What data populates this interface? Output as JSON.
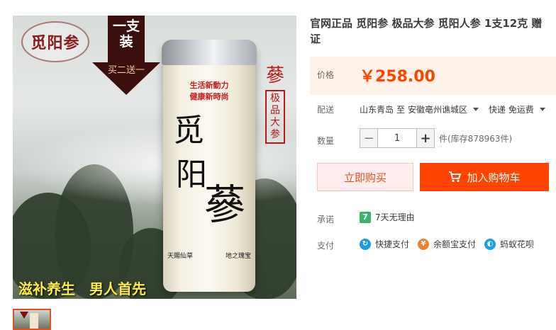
{
  "image": {
    "brand_seal": "觅阳参",
    "promo_line": "一支装",
    "promo_ribbon": "买二送一",
    "can": {
      "slogan_1": "生活新動力",
      "slogan_2": "健康新時尚",
      "calligraphy": [
        "觅",
        "阳",
        "蔘"
      ],
      "bottom_left": "天賜仙草",
      "bottom_right": "地之瑰宝"
    },
    "side_big": "蔘",
    "side_box": "极品大参",
    "bottom_slogan_1": "滋补养生",
    "bottom_slogan_2": "男人首先"
  },
  "title": {
    "line1": "官网正品 觅阳参 极品大参 觅阳人参 1支12克 赠",
    "line2": "证"
  },
  "price": {
    "label": "价格",
    "value": "￥258.00",
    "color": "#ff4400"
  },
  "shipping": {
    "label": "配送",
    "origin": "山东青岛",
    "to": "至",
    "destination": "安徽亳州谯城区",
    "method": "快递 免运费"
  },
  "quantity": {
    "label": "数量",
    "value": "1",
    "minus": "−",
    "plus": "+",
    "stock": "件(库存878963件)"
  },
  "buttons": {
    "buy_now": "立即购买",
    "add_cart": "加入购物车",
    "cart_icon": "cart-icon"
  },
  "promise": {
    "label": "承诺",
    "icon_text": "7",
    "text": "7天无理由"
  },
  "payment": {
    "label": "支付",
    "methods": [
      {
        "icon": "quick-pay-icon",
        "label": "快捷支付",
        "color": "#1d9be0"
      },
      {
        "icon": "yuebao-icon",
        "label": "余额宝支付",
        "color": "#f0812c"
      },
      {
        "icon": "huabei-icon",
        "label": "蚂蚁花呗",
        "color": "#1aa0e6"
      }
    ]
  }
}
